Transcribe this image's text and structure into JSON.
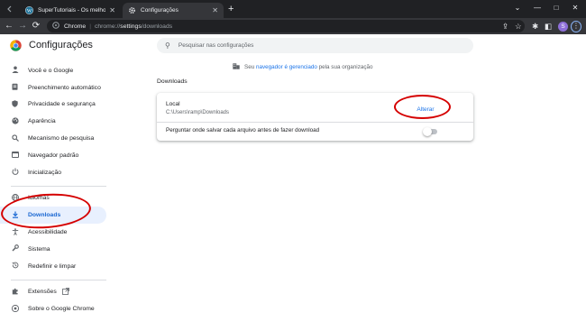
{
  "window": {
    "tabs": [
      {
        "title": "SuperTutoriais - Os melhores tut",
        "active": false
      },
      {
        "title": "Configurações",
        "active": true
      }
    ],
    "new_tab_glyph": "+",
    "controls": {
      "minimize": "—",
      "maximize": "□",
      "close": "✕"
    }
  },
  "toolbar": {
    "back_icon": "←",
    "forward_icon": "→",
    "reload_icon": "⟳",
    "omnibox": {
      "scheme_label": "Chrome",
      "url_prefix": "chrome://",
      "url_bold": "settings",
      "url_rest": "/downloads"
    },
    "profile_initial": "S",
    "menu_glyph": "⋮"
  },
  "settings": {
    "title": "Configurações",
    "search_placeholder": "Pesquisar nas configurações",
    "managed": {
      "prefix": "Seu ",
      "link": "navegador é gerenciado",
      "suffix": " pela sua organização"
    }
  },
  "sidebar": {
    "items": [
      {
        "label": "Você e o Google",
        "icon": "person-icon",
        "glyph": "👤"
      },
      {
        "label": "Preenchimento automático",
        "icon": "clipboard-icon",
        "glyph": "▤"
      },
      {
        "label": "Privacidade e segurança",
        "icon": "shield-icon",
        "glyph": "⛨"
      },
      {
        "label": "Aparência",
        "icon": "palette-icon",
        "glyph": "◉"
      },
      {
        "label": "Mecanismo de pesquisa",
        "icon": "search-icon",
        "glyph": "⚲"
      },
      {
        "label": "Navegador padrão",
        "icon": "browser-icon",
        "glyph": "▭"
      },
      {
        "label": "Inicialização",
        "icon": "power-icon",
        "glyph": "⏻"
      },
      {
        "label": "Idiomas",
        "icon": "globe-icon",
        "glyph": "◍"
      },
      {
        "label": "Downloads",
        "icon": "download-icon",
        "glyph": "⤓",
        "active": true
      },
      {
        "label": "Acessibilidade",
        "icon": "accessibility-icon",
        "glyph": "♿"
      },
      {
        "label": "Sistema",
        "icon": "wrench-icon",
        "glyph": "🔧"
      },
      {
        "label": "Redefinir e limpar",
        "icon": "history-icon",
        "glyph": "↺"
      },
      {
        "label": "Extensões",
        "icon": "puzzle-icon",
        "glyph": "✱"
      },
      {
        "label": "Sobre o Google Chrome",
        "icon": "chrome-icon",
        "glyph": "◎"
      }
    ]
  },
  "downloads": {
    "section_title": "Downloads",
    "location_label": "Local",
    "location_path": "C:\\Users\\ramp\\Downloads",
    "change_button": "Alterar",
    "ask_label": "Perguntar onde salvar cada arquivo antes de fazer download",
    "ask_enabled": false
  },
  "colors": {
    "accent": "#1a73e8",
    "annotation": "#d50000",
    "active_nav_bg": "#e8f0fe"
  }
}
